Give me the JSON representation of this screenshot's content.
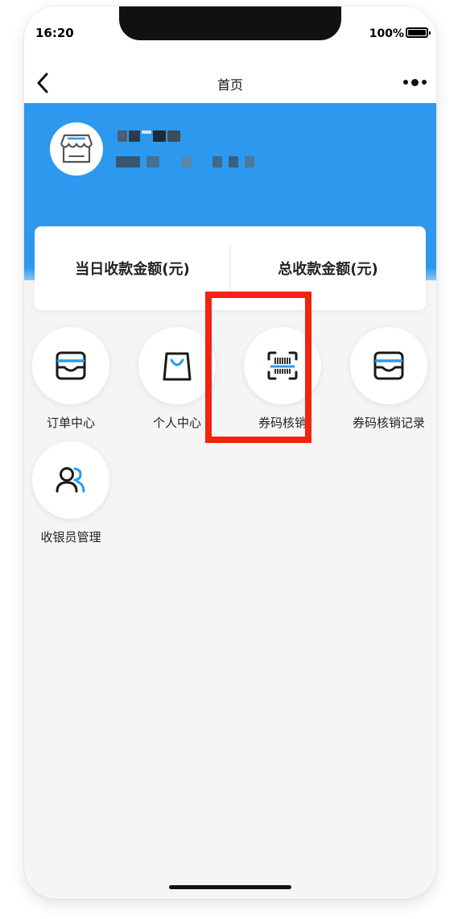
{
  "status_bar": {
    "time": "16:20",
    "battery": "100%"
  },
  "navbar": {
    "title": "首页"
  },
  "banner": {
    "shop_name_blocks": [
      "#4a5f73",
      "#2a3b4c",
      "#d8e6f2",
      "#1e2933",
      "#3a4c5d"
    ],
    "shop_sub_blocks": [
      "#39556f",
      "#47718f",
      "#5a86a8",
      "#3f6a8c",
      "#375f82",
      "#4c7899"
    ]
  },
  "stats": {
    "today_label": "当日收款金额(元)",
    "total_label": "总收款金额(元)"
  },
  "menu": [
    {
      "label": "订单中心",
      "icon": "order-box-icon"
    },
    {
      "label": "个人中心",
      "icon": "shopping-bag-icon"
    },
    {
      "label": "券码核销",
      "icon": "barcode-scan-icon"
    },
    {
      "label": "券码核销记录",
      "icon": "order-box-icon"
    },
    {
      "label": "收银员管理",
      "icon": "users-icon"
    }
  ],
  "colors": {
    "brand_blue": "#2c99ee",
    "highlight_red": "#f2230f"
  }
}
